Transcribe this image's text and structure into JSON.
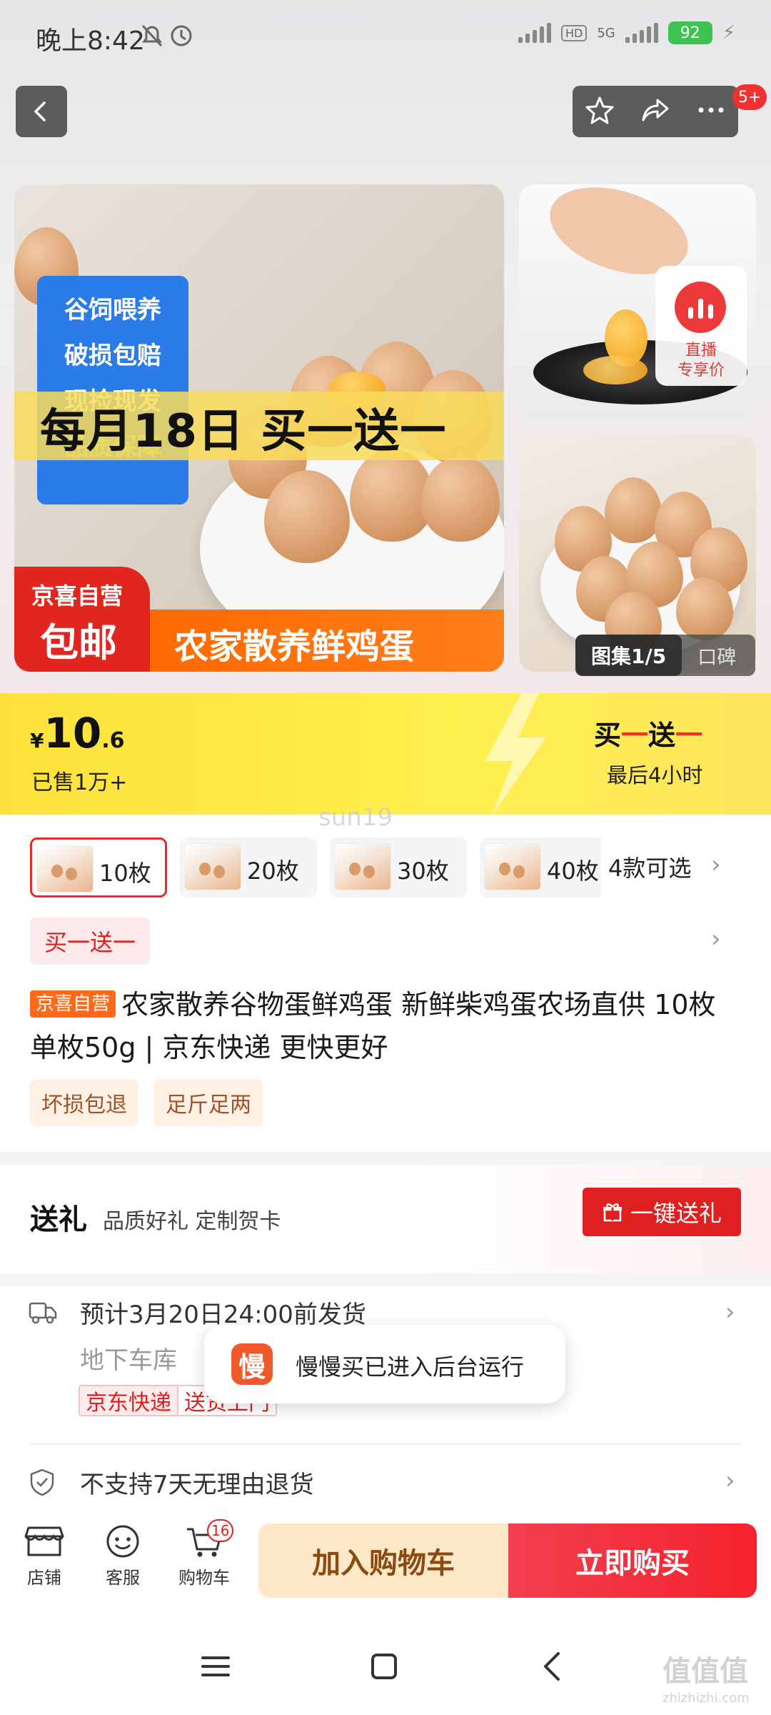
{
  "status_bar": {
    "time": "晚上8:42",
    "battery": "92",
    "network": "5G",
    "hd": "HD"
  },
  "header": {
    "notification_count": "5+"
  },
  "gallery": {
    "main_tags": [
      "谷饲喂养",
      "破损包赔",
      "现捡现发",
      "品质保障"
    ],
    "promo_headline": "每月18日 买一送一",
    "badge_line1": "京喜自营",
    "badge_line2": "包邮",
    "banner_text": "农家散养鲜鸡蛋",
    "live_label1": "直播",
    "live_label2": "专享价",
    "tab_active": "图集1/5",
    "tab_other": "口碑"
  },
  "price_band": {
    "currency": "¥",
    "price_int": "10",
    "price_dec": ".6",
    "sold": "已售1万+",
    "promo_a": "买",
    "promo_dash1": "一",
    "promo_b": "送",
    "promo_dash2": "一",
    "countdown": "最后4小时"
  },
  "watermark": "sun19",
  "sku": {
    "options": [
      {
        "label": "10枚",
        "selected": true
      },
      {
        "label": "20枚",
        "selected": false
      },
      {
        "label": "30枚",
        "selected": false
      },
      {
        "label": "40枚",
        "selected": false
      }
    ],
    "more": "4款可选"
  },
  "promo_tag": "买一送一",
  "product": {
    "store_tag": "京喜自营",
    "title": "农家散养谷物蛋鲜鸡蛋 新鲜柴鸡蛋农场直供 10枚 单枚50g | 京东快递 更快更好",
    "service_tags": [
      "坏损包退",
      "足斤足两"
    ]
  },
  "gift": {
    "title": "送礼",
    "subtitle": "品质好礼 定制贺卡",
    "button": "一键送礼"
  },
  "shipping": {
    "estimate": "预计3月20日24:00前发货",
    "address": "地下车库",
    "tag_a": "京东快递",
    "tag_b": "送货上门"
  },
  "toast": {
    "icon_char": "慢",
    "text": "慢慢买已进入后台运行"
  },
  "returns": {
    "text": "不支持7天无理由退货"
  },
  "bottom_nav": {
    "store": "店铺",
    "service": "客服",
    "cart": "购物车",
    "cart_count": "16",
    "add_to_cart": "加入购物车",
    "buy_now": "立即购买"
  },
  "site_mark": {
    "logo": "值值值",
    "domain": "zhizhizhi.com"
  },
  "colors": {
    "brand_red": "#f5222d",
    "promo_yellow": "#fde13a",
    "store_orange": "#ff6a1a"
  }
}
